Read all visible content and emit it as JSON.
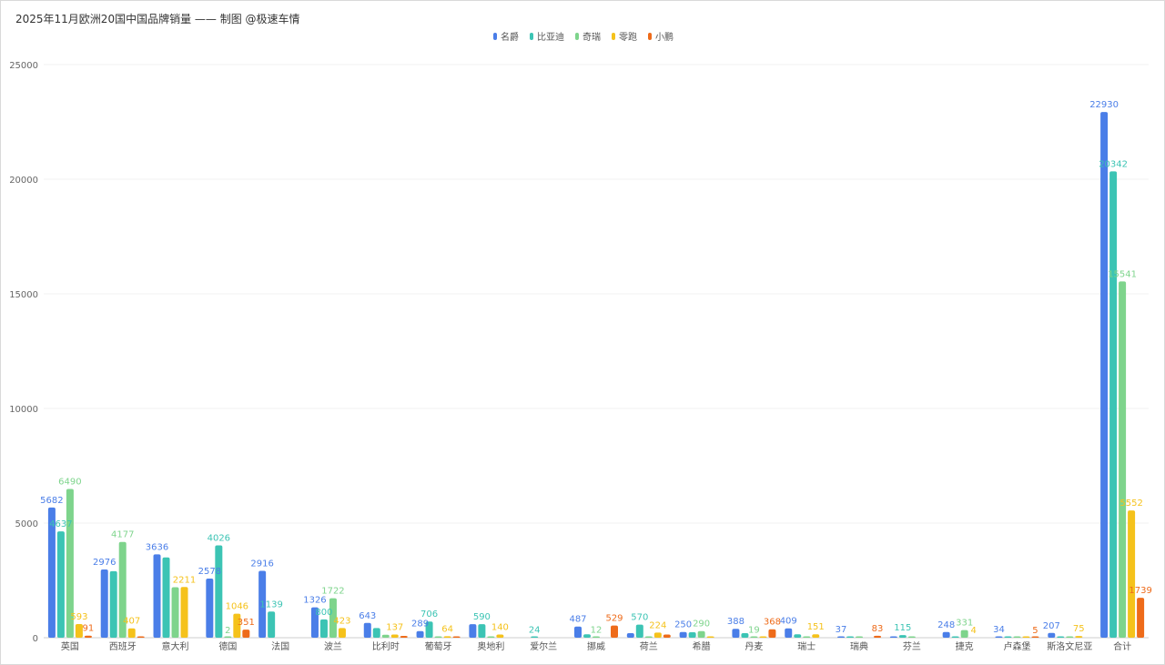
{
  "chart_data": {
    "type": "bar",
    "title": "2025年11月欧洲20国中国品牌销量 —— 制图 @极速车情",
    "xlabel": "",
    "ylabel": "",
    "ylim": [
      0,
      25000
    ],
    "yticks": [
      0,
      5000,
      10000,
      15000,
      20000,
      25000
    ],
    "grid": true,
    "legend_position": "top-center",
    "categories": [
      "英国",
      "西班牙",
      "意大利",
      "德国",
      "法国",
      "波兰",
      "比利时",
      "葡萄牙",
      "奥地利",
      "爱尔兰",
      "挪威",
      "荷兰",
      "希腊",
      "丹麦",
      "瑞士",
      "瑞典",
      "芬兰",
      "捷克",
      "卢森堡",
      "斯洛文尼亚",
      "合计"
    ],
    "series": [
      {
        "name": "名爵",
        "color": "#4a7ee8",
        "values": [
          5682,
          2976,
          3636,
          2578,
          2916,
          1326,
          643,
          289,
          590,
          0,
          487,
          200,
          250,
          388,
          409,
          37,
          40,
          248,
          34,
          207,
          22930
        ]
      },
      {
        "name": "比亚迪",
        "color": "#3cc4b4",
        "values": [
          4637,
          2900,
          3500,
          4026,
          1139,
          800,
          420,
          706,
          590,
          24,
          150,
          570,
          240,
          200,
          150,
          25,
          115,
          40,
          20,
          20,
          20342
        ]
      },
      {
        "name": "奇瑞",
        "color": "#7ed48c",
        "values": [
          6490,
          4177,
          2200,
          2,
          0,
          1722,
          130,
          40,
          30,
          0,
          12,
          40,
          290,
          19,
          30,
          20,
          30,
          331,
          10,
          40,
          15541
        ]
      },
      {
        "name": "零跑",
        "color": "#f5c21b",
        "values": [
          593,
          407,
          2211,
          1046,
          0,
          423,
          137,
          64,
          140,
          0,
          0,
          224,
          40,
          30,
          151,
          0,
          0,
          0,
          4,
          75,
          5552
        ]
      },
      {
        "name": "小鹏",
        "color": "#ee6b1a",
        "values": [
          91,
          30,
          0,
          351,
          0,
          0,
          80,
          30,
          0,
          0,
          529,
          140,
          0,
          368,
          0,
          83,
          0,
          0,
          5,
          0,
          1739
        ]
      }
    ],
    "data_labels": [
      {
        "category": 0,
        "series": 0,
        "text": "5682"
      },
      {
        "category": 0,
        "series": 1,
        "text": "4637"
      },
      {
        "category": 0,
        "series": 2,
        "text": "6490"
      },
      {
        "category": 0,
        "series": 3,
        "text": "593"
      },
      {
        "category": 0,
        "series": 4,
        "text": "91"
      },
      {
        "category": 1,
        "series": 0,
        "text": "2976"
      },
      {
        "category": 1,
        "series": 2,
        "text": "4177"
      },
      {
        "category": 1,
        "series": 3,
        "text": "407"
      },
      {
        "category": 2,
        "series": 0,
        "text": "3636"
      },
      {
        "category": 2,
        "series": 3,
        "text": "2211"
      },
      {
        "category": 3,
        "series": 0,
        "text": "2578"
      },
      {
        "category": 3,
        "series": 1,
        "text": "4026"
      },
      {
        "category": 3,
        "series": 2,
        "text": "2"
      },
      {
        "category": 3,
        "series": 3,
        "text": "1046"
      },
      {
        "category": 3,
        "series": 4,
        "text": "351"
      },
      {
        "category": 4,
        "series": 0,
        "text": "2916"
      },
      {
        "category": 4,
        "series": 1,
        "text": "1139"
      },
      {
        "category": 5,
        "series": 0,
        "text": "1326"
      },
      {
        "category": 5,
        "series": 1,
        "text": "800"
      },
      {
        "category": 5,
        "series": 2,
        "text": "1722"
      },
      {
        "category": 5,
        "series": 3,
        "text": "423"
      },
      {
        "category": 6,
        "series": 0,
        "text": "643"
      },
      {
        "category": 6,
        "series": 3,
        "text": "137"
      },
      {
        "category": 7,
        "series": 0,
        "text": "289"
      },
      {
        "category": 7,
        "series": 1,
        "text": "706"
      },
      {
        "category": 7,
        "series": 3,
        "text": "64"
      },
      {
        "category": 8,
        "series": 1,
        "text": "590"
      },
      {
        "category": 8,
        "series": 3,
        "text": "140"
      },
      {
        "category": 9,
        "series": 1,
        "text": "24"
      },
      {
        "category": 10,
        "series": 0,
        "text": "487"
      },
      {
        "category": 10,
        "series": 2,
        "text": "12"
      },
      {
        "category": 10,
        "series": 4,
        "text": "529"
      },
      {
        "category": 11,
        "series": 1,
        "text": "570"
      },
      {
        "category": 11,
        "series": 3,
        "text": "224"
      },
      {
        "category": 12,
        "series": 0,
        "text": "250"
      },
      {
        "category": 12,
        "series": 2,
        "text": "290"
      },
      {
        "category": 13,
        "series": 0,
        "text": "388"
      },
      {
        "category": 13,
        "series": 2,
        "text": "19"
      },
      {
        "category": 13,
        "series": 4,
        "text": "368"
      },
      {
        "category": 14,
        "series": 0,
        "text": "409"
      },
      {
        "category": 14,
        "series": 3,
        "text": "151"
      },
      {
        "category": 15,
        "series": 0,
        "text": "37"
      },
      {
        "category": 15,
        "series": 4,
        "text": "83"
      },
      {
        "category": 16,
        "series": 1,
        "text": "115"
      },
      {
        "category": 17,
        "series": 0,
        "text": "248"
      },
      {
        "category": 17,
        "series": 2,
        "text": "331"
      },
      {
        "category": 17,
        "series": 3,
        "text": "4"
      },
      {
        "category": 18,
        "series": 0,
        "text": "34"
      },
      {
        "category": 18,
        "series": 4,
        "text": "5"
      },
      {
        "category": 19,
        "series": 0,
        "text": "207"
      },
      {
        "category": 19,
        "series": 3,
        "text": "75"
      },
      {
        "category": 20,
        "series": 0,
        "text": "22930"
      },
      {
        "category": 20,
        "series": 1,
        "text": "20342"
      },
      {
        "category": 20,
        "series": 2,
        "text": "15541"
      },
      {
        "category": 20,
        "series": 3,
        "text": "5552"
      },
      {
        "category": 20,
        "series": 4,
        "text": "1739"
      }
    ]
  }
}
